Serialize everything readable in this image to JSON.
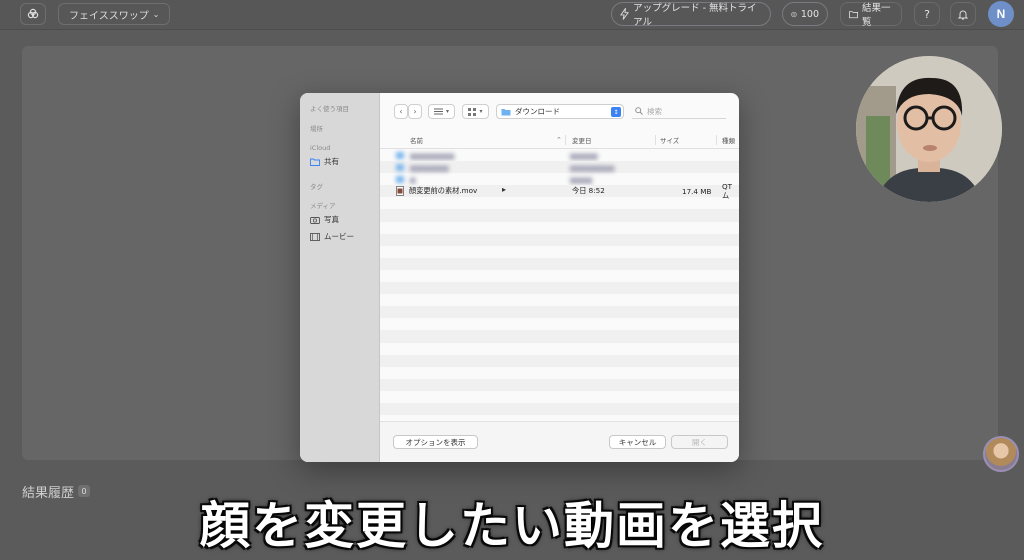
{
  "topbar": {
    "app_name": "フェイススワップ",
    "upgrade_label": "アップグレード - 無料トライアル",
    "credits": "100",
    "results_label": "結果一覧",
    "help_label": "?",
    "avatar_initial": "N"
  },
  "history": {
    "label": "結果履歴",
    "count": "0"
  },
  "subtitle": "顔を変更したい動画を選択",
  "dialog": {
    "sidebar": {
      "favorites_heading": "よく使う項目",
      "locations_heading": "場所",
      "icloud_heading": "iCloud",
      "shared_label": "共有",
      "tags_heading": "タグ",
      "media_heading": "メディア",
      "photos_label": "写真",
      "movies_label": "ムービー"
    },
    "location": "ダウンロード",
    "search_placeholder": "検索",
    "columns": {
      "name": "名前",
      "modified": "変更日",
      "size": "サイズ",
      "kind": "種類"
    },
    "files": [
      {
        "name": "顔変更前の素材.mov",
        "modified": "今日 8:52",
        "size": "17.4 MB",
        "kind": "QT ム"
      }
    ],
    "options_button": "オプションを表示",
    "cancel_button": "キャンセル",
    "open_button": "開く"
  }
}
